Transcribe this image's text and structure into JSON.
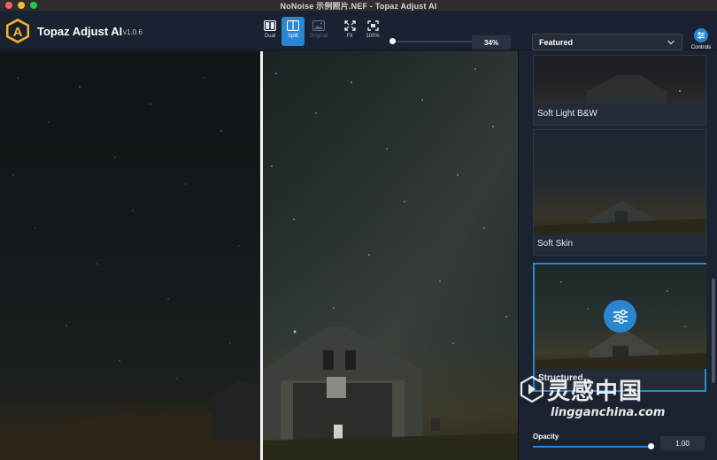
{
  "window": {
    "title": "NoNoise 示例照片.NEF - Topaz Adjust AI"
  },
  "app": {
    "name": "Topaz Adjust AI",
    "version": "v1.0.6",
    "logo_letter": "A"
  },
  "view_buttons": [
    {
      "label": "Dual",
      "icon": "dual-view-icon"
    },
    {
      "label": "Split",
      "icon": "split-view-icon",
      "active": true
    },
    {
      "label": "Original",
      "icon": "original-image-icon",
      "disabled": true
    },
    {
      "label": "Fit",
      "icon": "fit-icon"
    },
    {
      "label": "100%",
      "icon": "actual-size-icon"
    }
  ],
  "zoom": {
    "value_label": "34%",
    "fraction": 0.0
  },
  "preset_filter": {
    "selected": "Featured"
  },
  "controls_button": {
    "label": "Controls"
  },
  "presets": [
    {
      "name": "Soft Light B&W"
    },
    {
      "name": "Soft Skin"
    },
    {
      "name": "Structured",
      "selected": true
    }
  ],
  "opacity": {
    "label": "Opacity",
    "value": "1.00",
    "fraction": 1.0
  },
  "watermark": {
    "cn": "灵感中国",
    "en": "lingganchina.com"
  },
  "colors": {
    "accent": "#2a86d1",
    "background": "#1c2330",
    "logo_gold": "#f0b429"
  }
}
